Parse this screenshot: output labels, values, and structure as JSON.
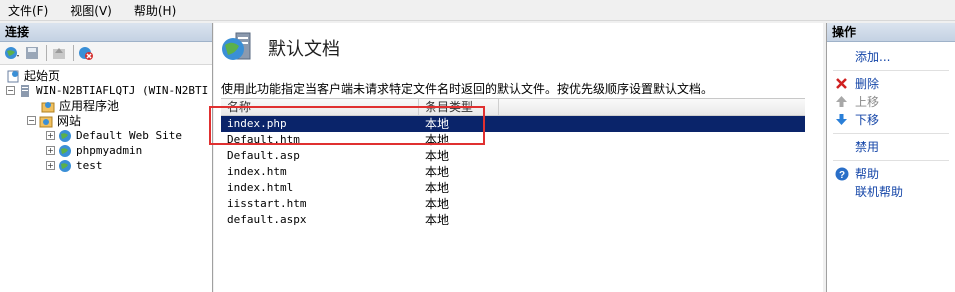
{
  "menu": [
    "文件(F)",
    "视图(V)",
    "帮助(H)"
  ],
  "connections": {
    "title": "连接",
    "tree": {
      "start_page": "起始页",
      "server": "WIN-N2BTIAFLQTJ (WIN-N2BTI",
      "app_pools": "应用程序池",
      "sites": "网站",
      "site_items": [
        "Default Web Site",
        "phpmyadmin",
        "test"
      ]
    }
  },
  "feature": {
    "title": "默认文档",
    "description": "使用此功能指定当客户端未请求特定文件名时返回的默认文件。按优先级顺序设置默认文档。",
    "columns": [
      "名称",
      "条目类型"
    ],
    "rows": [
      {
        "name": "index.php",
        "type": "本地"
      },
      {
        "name": "Default.htm",
        "type": "本地"
      },
      {
        "name": "Default.asp",
        "type": "本地"
      },
      {
        "name": "index.htm",
        "type": "本地"
      },
      {
        "name": "index.html",
        "type": "本地"
      },
      {
        "name": "iisstart.htm",
        "type": "本地"
      },
      {
        "name": "default.aspx",
        "type": "本地"
      }
    ]
  },
  "actions": {
    "title": "操作",
    "add": "添加...",
    "remove": "删除",
    "move_up": "上移",
    "move_down": "下移",
    "disable": "禁用",
    "help": "帮助",
    "online_help": "联机帮助"
  },
  "colors": {
    "selection": "#0a246a",
    "annotation": "#e03030",
    "link": "#1546a8"
  }
}
